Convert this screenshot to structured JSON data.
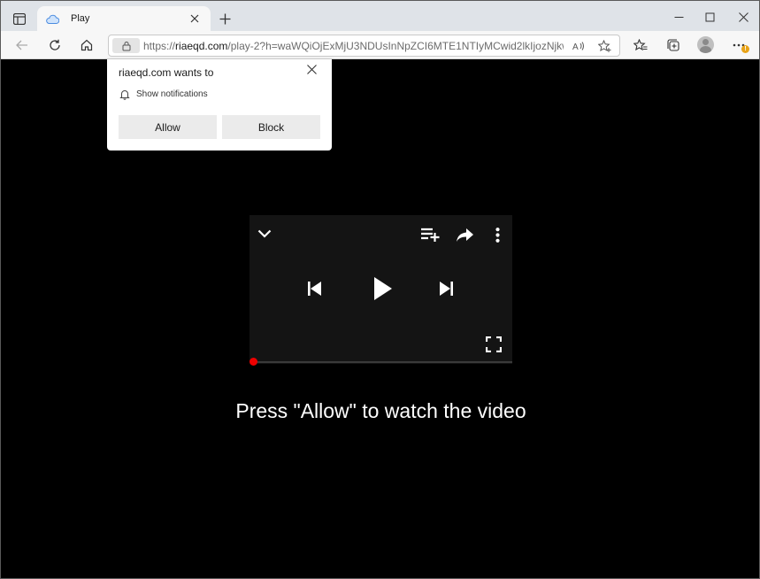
{
  "tab": {
    "title": "Play"
  },
  "address": {
    "scheme": "https://",
    "host": "riaeqd.com",
    "path": "/play-2?h=waWQiOjExMjU3NDUsInNpZCI6MTE1NTIyMCwid2lkIjozNjkw..."
  },
  "toolbar": {
    "notification_badge": "!"
  },
  "popup": {
    "title": "riaeqd.com wants to",
    "permission": "Show notifications",
    "allow_label": "Allow",
    "block_label": "Block"
  },
  "player": {
    "progress": 0.0
  },
  "page": {
    "cta": "Press \"Allow\" to watch the video"
  },
  "colors": {
    "accent_progress": "#ee0000",
    "popup_bg": "#ffffff",
    "page_bg": "#000000"
  }
}
